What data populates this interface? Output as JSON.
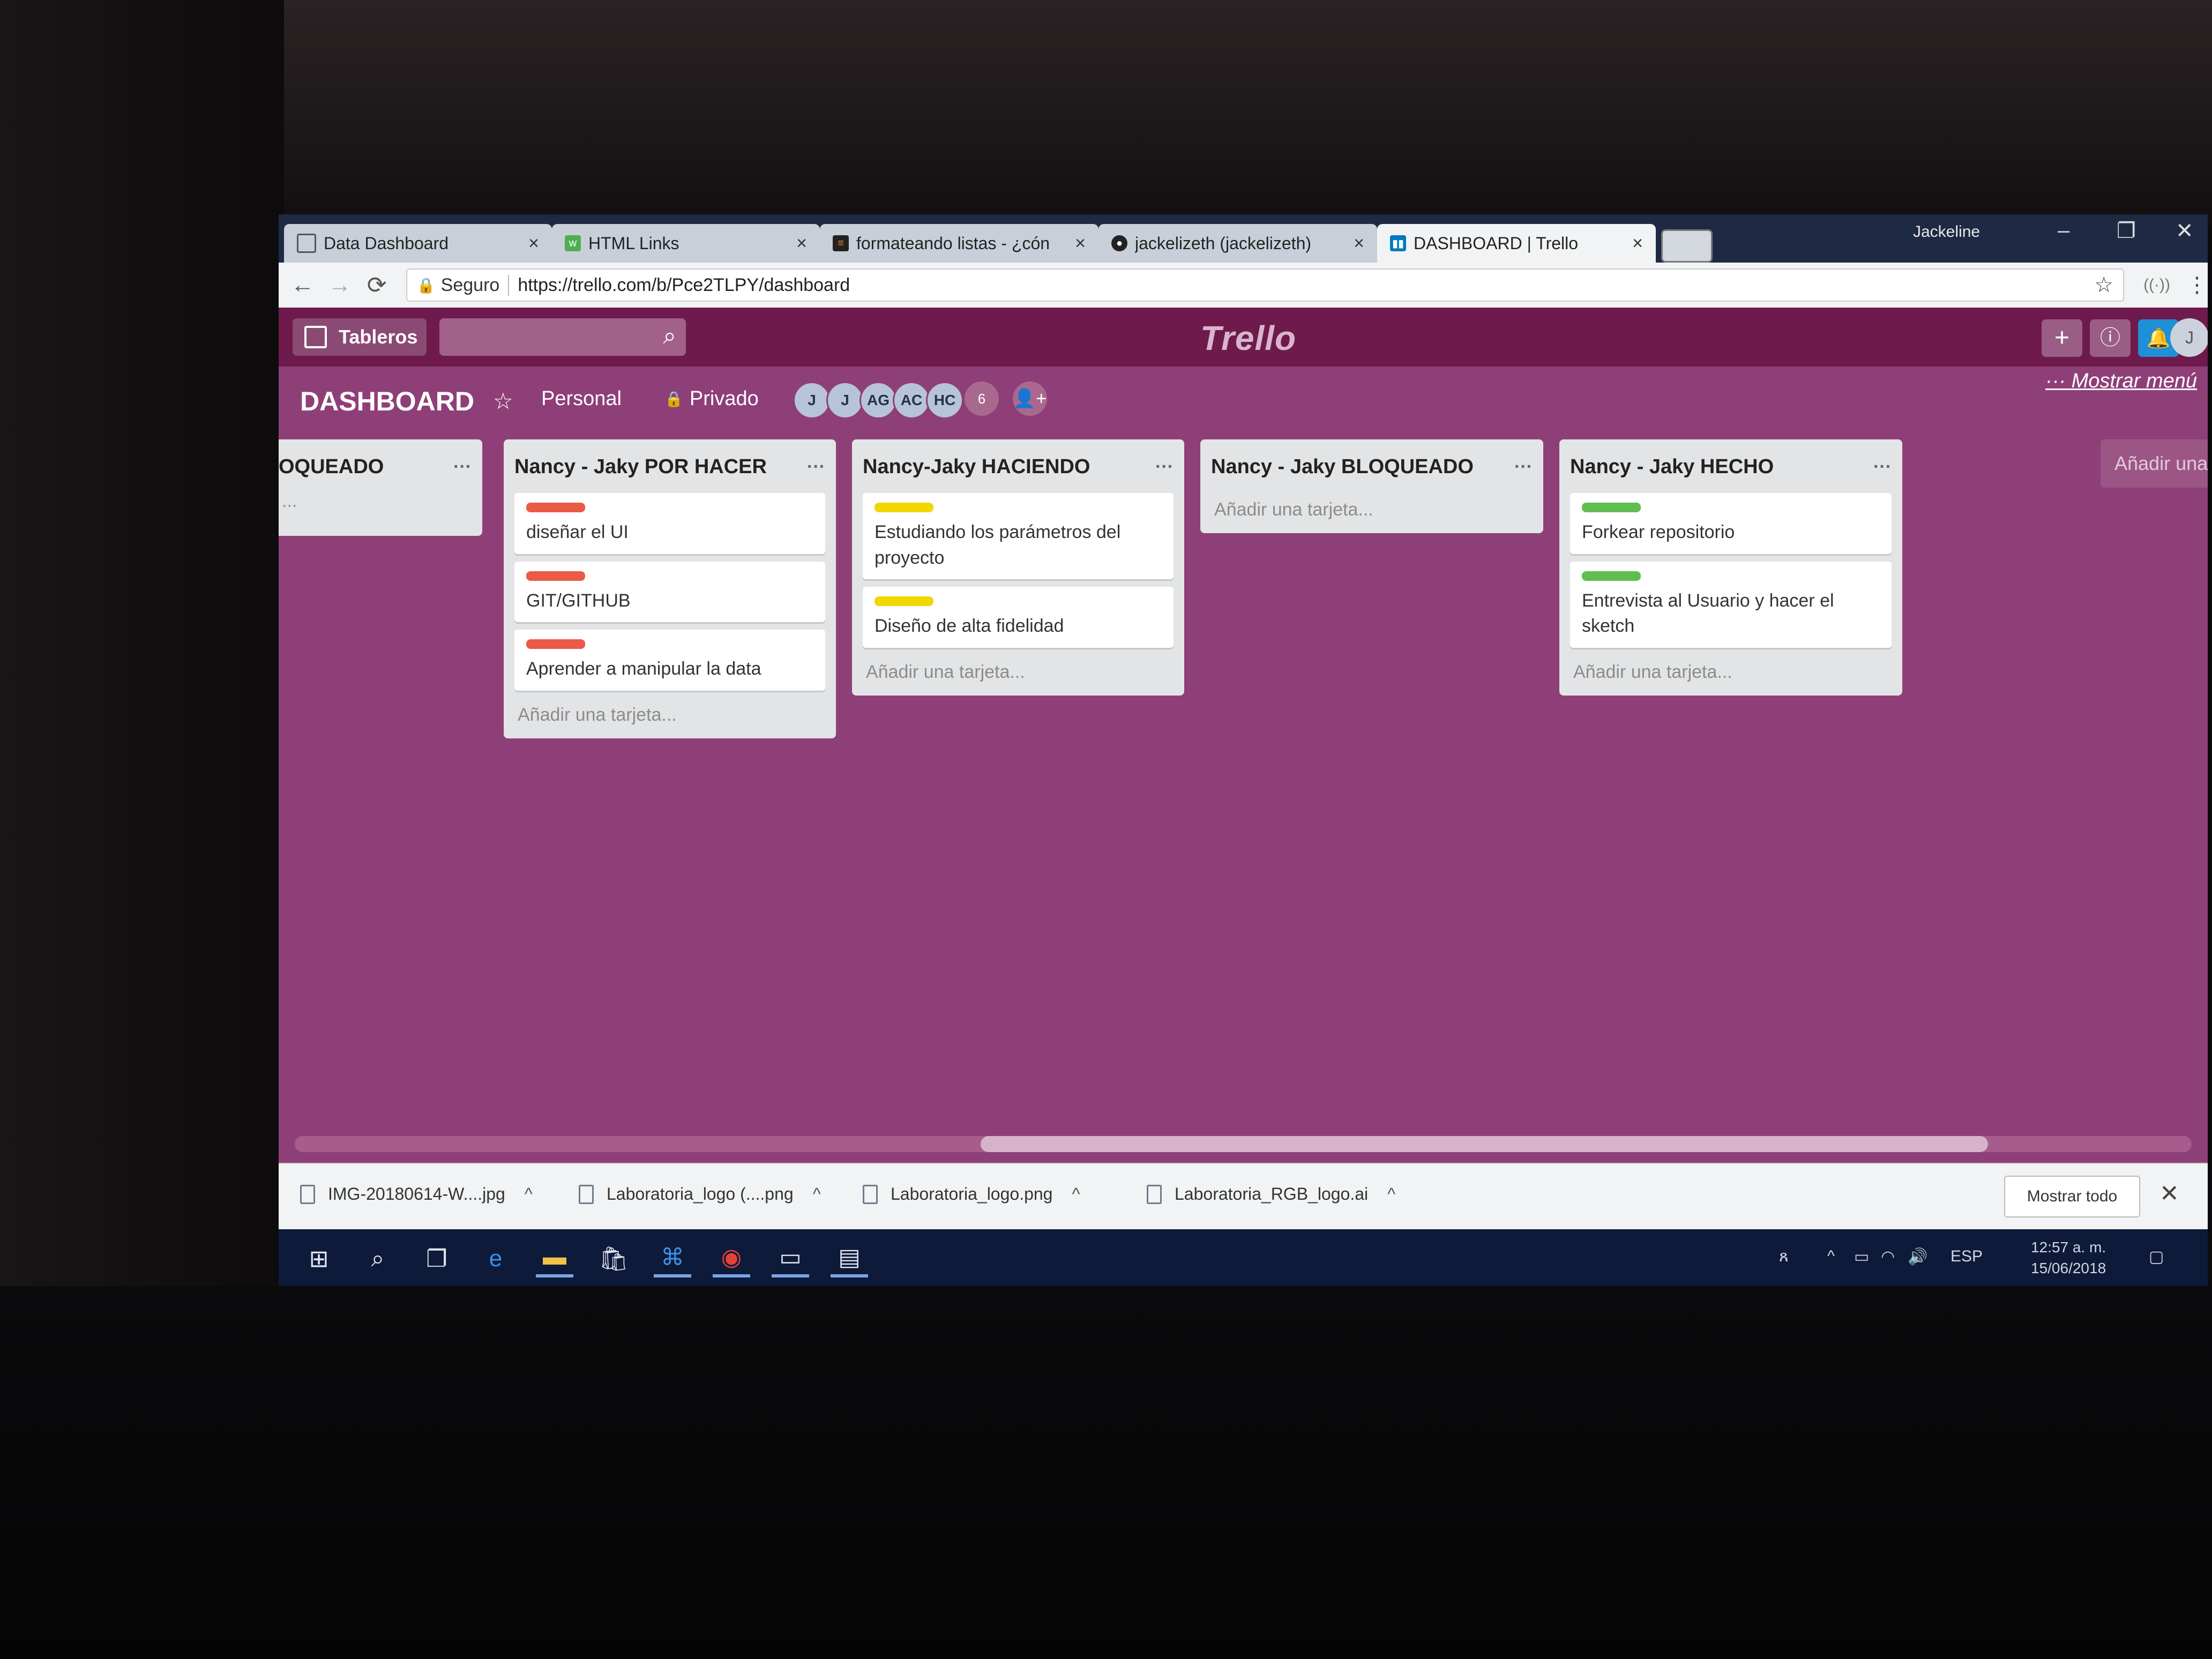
{
  "browser": {
    "tabs": [
      {
        "title": "Data Dashboard",
        "favicon": "document-icon",
        "active": false
      },
      {
        "title": "HTML Links",
        "favicon": "w3-icon",
        "active": false
      },
      {
        "title": "formateando listas - ¿cón",
        "favicon": "stackoverflow-icon",
        "active": false
      },
      {
        "title": "jackelizeth (jackelizeth)",
        "favicon": "github-icon",
        "active": false
      },
      {
        "title": "DASHBOARD | Trello",
        "favicon": "trello-icon",
        "active": true
      }
    ],
    "window_user": "Jackeline",
    "secure_label": "Seguro",
    "url": "https://trello.com/b/Pce2TLPY/dashboard"
  },
  "trello_header": {
    "boards_label": "Tableros",
    "logo": "Trello",
    "icons": [
      "plus-icon",
      "info-icon",
      "bell-icon"
    ],
    "user_initial": "J"
  },
  "board": {
    "title": "DASHBOARD",
    "team": "Personal",
    "visibility": "Privado",
    "members": [
      "J",
      "J",
      "AG",
      "AC",
      "HC"
    ],
    "member_count": "6",
    "show_menu": "Mostrar menú",
    "add_list": "Añadir una"
  },
  "lists": [
    {
      "title": "OQUEADO",
      "cards": [],
      "add_card": "..."
    },
    {
      "title": "Nancy - Jaky POR HACER",
      "cards": [
        {
          "label_color": "#eb5a46",
          "text": "diseñar el UI"
        },
        {
          "label_color": "#eb5a46",
          "text": "GIT/GITHUB"
        },
        {
          "label_color": "#eb5a46",
          "text": "Aprender a manipular la data"
        }
      ],
      "add_card": "Añadir una tarjeta..."
    },
    {
      "title": "Nancy-Jaky HACIENDO",
      "cards": [
        {
          "label_color": "#f2d600",
          "text": "Estudiando los parámetros del proyecto"
        },
        {
          "label_color": "#f2d600",
          "text": "Diseño de alta fidelidad"
        }
      ],
      "add_card": "Añadir una tarjeta..."
    },
    {
      "title": "Nancy - Jaky BLOQUEADO",
      "cards": [],
      "add_card": "Añadir una tarjeta..."
    },
    {
      "title": "Nancy - Jaky HECHO",
      "cards": [
        {
          "label_color": "#61bd4f",
          "text": "Forkear repositorio"
        },
        {
          "label_color": "#61bd4f",
          "text": "Entrevista al Usuario y hacer el sketch"
        }
      ],
      "add_card": "Añadir una tarjeta..."
    }
  ],
  "downloads": {
    "items": [
      "IMG-20180614-W....jpg",
      "Laboratoria_logo (....png",
      "Laboratoria_logo.png",
      "Laboratoria_RGB_logo.ai"
    ],
    "show_all": "Mostrar todo"
  },
  "taskbar": {
    "language": "ESP",
    "time": "12:57 a. m.",
    "date": "15/06/2018"
  }
}
